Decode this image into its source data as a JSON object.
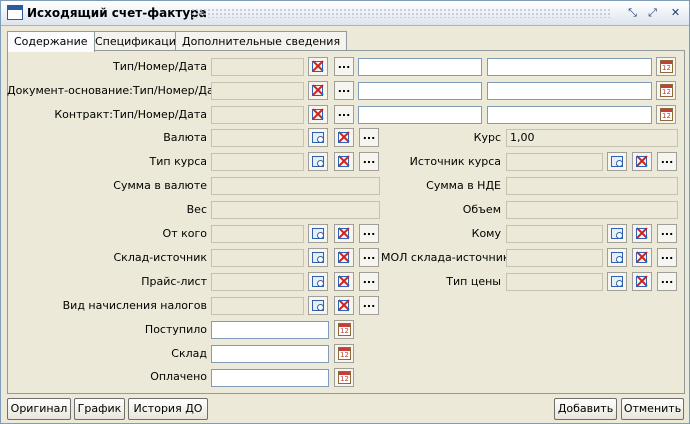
{
  "window": {
    "title": "Исходящий счет-фактура"
  },
  "tabs": [
    {
      "label": "Содержание",
      "active": true
    },
    {
      "label": "Спецификации",
      "active": false
    },
    {
      "label": "Дополнительные сведения",
      "active": false
    }
  ],
  "labels": {
    "type_number_date": "Тип/Номер/Дата",
    "basis_doc": "Документ-основание:Тип/Номер/Дата",
    "contract": "Контракт:Тип/Номер/Дата",
    "currency": "Валюта",
    "rate_type": "Тип курса",
    "amount_currency": "Сумма в валюте",
    "weight": "Вес",
    "from_whom": "От кого",
    "source_warehouse": "Склад-источник",
    "price_list": "Прайс-лист",
    "tax_type": "Вид начисления налогов",
    "received": "Поступило",
    "warehouse": "Склад",
    "paid": "Оплачено",
    "rate": "Курс",
    "rate_source": "Источник курса",
    "amount_nde": "Сумма в НДЕ",
    "volume": "Объем",
    "to_whom": "Кому",
    "mol_source": "МОЛ склада-источника",
    "price_type": "Тип цены"
  },
  "values": {
    "rate": "1,00"
  },
  "icons": {
    "dots": "..."
  },
  "buttons": {
    "original": "Оригинал",
    "schedule": "График",
    "history": "История ДО",
    "add": "Добавить",
    "cancel": "Отменить"
  },
  "colors": {
    "clear_icon": "#d02020",
    "lookup_icon": "#3060b0",
    "window_border": "#7f9db9"
  }
}
